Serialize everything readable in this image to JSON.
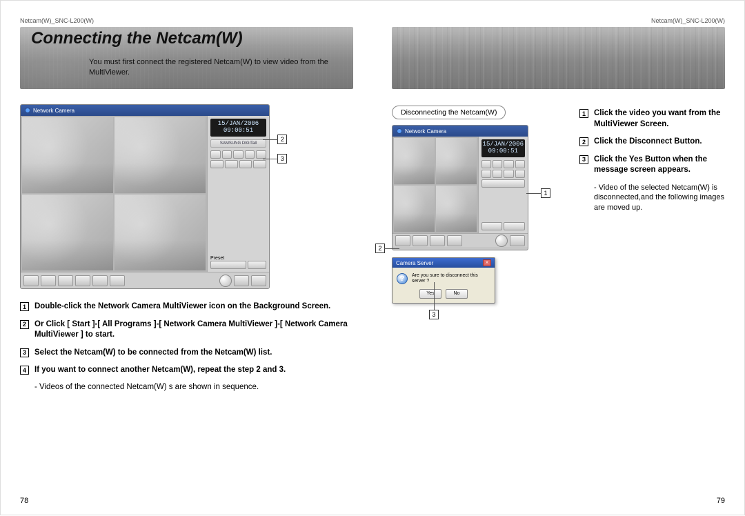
{
  "header": {
    "left": "Netcam(W)_SNC-L200(W)",
    "right": "Netcam(W)_SNC-L200(W)"
  },
  "title": "Connecting the Netcam(W)",
  "subtitle": "You must first connect the registered Netcam(W) to view video from the MultiViewer.",
  "screenshot_a": {
    "window_title": "Network Camera",
    "lcd_date": "15/JAN/2006",
    "lcd_time": "09:00:51",
    "brand": "SAMSUNG DIGITall",
    "preset_label": "Preset"
  },
  "callouts_a": [
    "2",
    "3"
  ],
  "steps_a": [
    {
      "num": "1",
      "text": "Double-click the Network Camera MultiViewer icon on the Background Screen."
    },
    {
      "num": "2",
      "text": "Or Click [ Start ]-[ All Programs ]-[ Network Camera MultiViewer ]-[ Network Camera MultiViewer ] to start."
    },
    {
      "num": "3",
      "text": "Select the Netcam(W) to be connected from the Netcam(W) list."
    },
    {
      "num": "4",
      "text": "If you want to connect another Netcam(W), repeat the step 2 and 3."
    }
  ],
  "note_a": "- Videos of the connected Netcam(W) s are shown in sequence.",
  "page_left": "78",
  "disconnecting_label": "Disconnecting the Netcam(W)",
  "screenshot_b": {
    "window_title": "Network Camera",
    "lcd_date": "15/JAN/2006",
    "lcd_time": "09:00:51"
  },
  "callouts_b": {
    "c1": "1",
    "c2": "2",
    "c3": "3"
  },
  "dialog": {
    "title": "Camera Server",
    "message": "Are you sure to disconnect this server ?",
    "yes": "Yes",
    "no": "No",
    "close": "×"
  },
  "steps_b": [
    {
      "num": "1",
      "text": "Click the video you want from the MultiViewer Screen."
    },
    {
      "num": "2",
      "text": "Click the Disconnect Button."
    },
    {
      "num": "3",
      "text": "Click the Yes Button when the message screen appears."
    }
  ],
  "note_b": "- Video of the selected Netcam(W) is disconnected,and the following images are moved up.",
  "page_right": "79"
}
